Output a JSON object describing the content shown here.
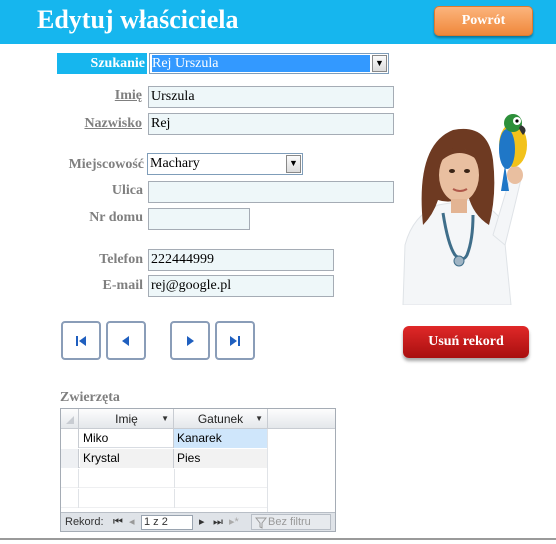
{
  "header": {
    "title": "Edytuj właściciela",
    "back_button": "Powrót"
  },
  "search": {
    "label": "Szukanie",
    "value": "Rej Urszula"
  },
  "form": {
    "first_name": {
      "label": "Imię",
      "value": "Urszula"
    },
    "last_name": {
      "label": "Nazwisko",
      "value": "Rej"
    },
    "city": {
      "label": "Miejscowość",
      "value": "Machary"
    },
    "street": {
      "label": "Ulica",
      "value": ""
    },
    "house_no": {
      "label": "Nr domu",
      "value": ""
    },
    "phone": {
      "label": "Telefon",
      "value": "222444999"
    },
    "email": {
      "label": "E-mail",
      "value": "rej@google.pl"
    }
  },
  "record_nav": {
    "first": "first-record-icon",
    "prev": "previous-record-icon",
    "next": "next-record-icon",
    "last": "last-record-icon"
  },
  "delete_button": "Usuń rekord",
  "pets": {
    "label": "Zwierzęta",
    "columns": [
      "Imię",
      "Gatunek"
    ],
    "rows": [
      {
        "name": "Miko",
        "species": "Kanarek"
      },
      {
        "name": "Krystal",
        "species": "Pies"
      }
    ],
    "navigation": {
      "record_label": "Rekord:",
      "position": "1 z 2",
      "filter_label": "Bez filtru"
    }
  },
  "colors": {
    "header_bg": "#16b6ee",
    "back_button": "#f0883b",
    "delete_button": "#c01515",
    "field_bg": "#eef7f9"
  }
}
